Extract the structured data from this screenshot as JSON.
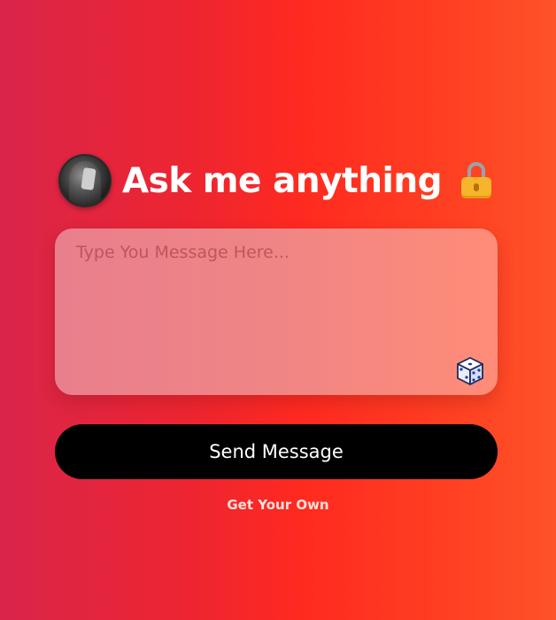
{
  "header": {
    "avatar_icon": "user-avatar",
    "title": "Ask me anything",
    "lock_icon": "lock-icon"
  },
  "message": {
    "placeholder": "Type You Message Here...",
    "value": "",
    "dice_icon": "dice-icon"
  },
  "actions": {
    "send_label": "Send Message",
    "get_own_label": "Get Your Own"
  },
  "colors": {
    "background_left": "#d9254a",
    "background_right": "#ff5228",
    "button": "#000000",
    "text": "#ffffff"
  }
}
